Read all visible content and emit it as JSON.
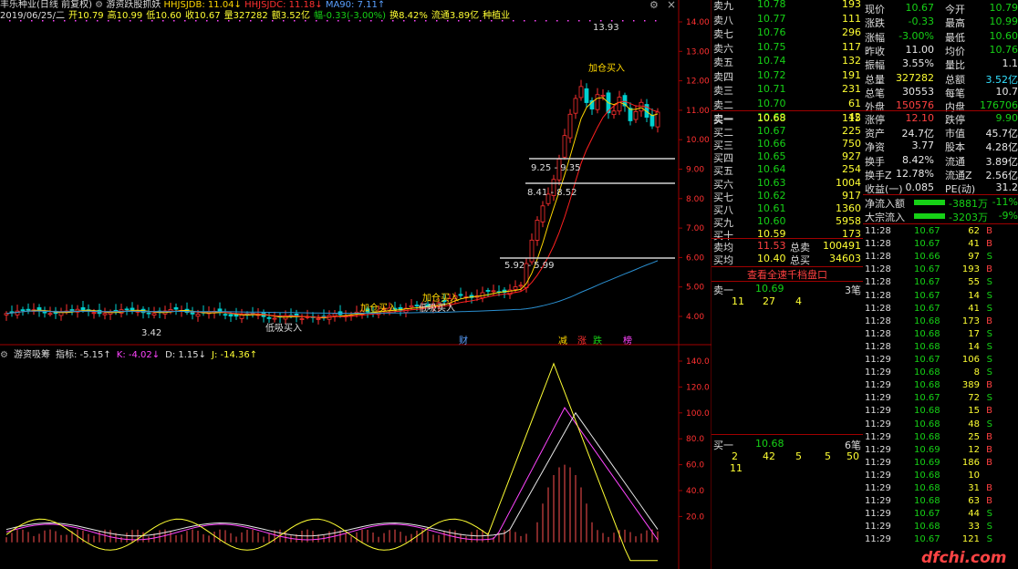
{
  "header": {
    "title": "丰乐种业(日线 前复权)",
    "indicator_name": "游资跃股抓妖",
    "hhjsjdb": "HHJSJDB: 11.04↓",
    "hhjsjdc": "HHJSJDC: 11.18↓",
    "ma90": "MA90: 7.11↑",
    "info_line": [
      "2019/06/25/二",
      "开10.79",
      "高10.99",
      "低10.60",
      "收10.67",
      "量327282",
      "额3.52亿",
      "幅-0.33(-3.00%)",
      "换8.42%",
      "流通3.89亿",
      "种植业"
    ]
  },
  "window_controls": {
    "gear": "⚙",
    "close": "×"
  },
  "main_chart": {
    "price_labels": [
      "14.00",
      "13.00",
      "12.00",
      "11.00",
      "10.00",
      "9.00",
      "8.00",
      "7.00",
      "6.00",
      "5.00",
      "4.00"
    ],
    "annotations": {
      "high": "13.93",
      "low": "3.42",
      "box1": "9.25 - 9.35",
      "box2": "8.41 - 8.52",
      "box3": "5.92 - 5.99",
      "buy1": "加仓买入",
      "buy2": "加仓买入",
      "buy3": "加仓买入",
      "buy4": "低吸买入",
      "buy5": "低吸买入",
      "cai": "财",
      "tags": [
        "减",
        "涨",
        "跌",
        "榜"
      ]
    },
    "colors": {
      "up": "#ff3030",
      "down": "#00d0d0",
      "ma_yellow": "#ffd700",
      "ma_red": "#ff2020",
      "ma_blue": "#2a8fd0"
    }
  },
  "sub_chart": {
    "name": "游资吸筹",
    "zhibiao": "指标: -5.15↑",
    "k": "K: -4.02↓",
    "d": "D: 1.15↓",
    "j": "J: -14.36↑",
    "labels": [
      "140.0",
      "120.0",
      "100.0",
      "80.0",
      "60.0",
      "40.0",
      "20.0"
    ]
  },
  "orderbook": {
    "sell": [
      {
        "label": "卖九",
        "price": "10.78",
        "vol": "193"
      },
      {
        "label": "卖八",
        "price": "10.77",
        "vol": "111"
      },
      {
        "label": "卖七",
        "price": "10.76",
        "vol": "296"
      },
      {
        "label": "卖六",
        "price": "10.75",
        "vol": "117"
      },
      {
        "label": "卖五",
        "price": "10.74",
        "vol": "132"
      },
      {
        "label": "卖四",
        "price": "10.72",
        "vol": "191"
      },
      {
        "label": "卖三",
        "price": "10.71",
        "vol": "231"
      },
      {
        "label": "卖二",
        "price": "10.70",
        "vol": "61"
      },
      {
        "label": "卖一",
        "price": "10.69",
        "vol": "42"
      }
    ],
    "buy": [
      {
        "label": "买一",
        "price": "10.68",
        "vol": "115"
      },
      {
        "label": "买二",
        "price": "10.67",
        "vol": "225"
      },
      {
        "label": "买三",
        "price": "10.66",
        "vol": "750"
      },
      {
        "label": "买四",
        "price": "10.65",
        "vol": "927"
      },
      {
        "label": "买五",
        "price": "10.64",
        "vol": "254"
      },
      {
        "label": "买六",
        "price": "10.63",
        "vol": "1004"
      },
      {
        "label": "买七",
        "price": "10.62",
        "vol": "917"
      },
      {
        "label": "买八",
        "price": "10.61",
        "vol": "1360"
      },
      {
        "label": "买九",
        "price": "10.60",
        "vol": "5958"
      },
      {
        "label": "买十",
        "price": "10.59",
        "vol": "173"
      }
    ],
    "avg_sell": {
      "label": "卖均",
      "price": "11.53",
      "tot_label": "总卖",
      "tot": "100491"
    },
    "avg_buy": {
      "label": "买均",
      "price": "10.40",
      "tot_label": "总买",
      "tot": "34603"
    },
    "view_all": "查看全速千档盘口",
    "sell1_detail": {
      "label": "卖一",
      "price": "10.69",
      "count": "3笔",
      "q": [
        "11",
        "27",
        "4"
      ]
    },
    "buy1_detail": {
      "label": "买一",
      "price": "10.68",
      "count": "6笔",
      "q": [
        "2",
        "42",
        "5",
        "5",
        "50",
        "11"
      ]
    }
  },
  "quote": [
    {
      "l1": "现价",
      "v1": "10.67",
      "l2": "今开",
      "v2": "10.79"
    },
    {
      "l1": "涨跌",
      "v1": "-0.33",
      "l2": "最高",
      "v2": "10.99"
    },
    {
      "l1": "涨幅",
      "v1": "-3.00%",
      "l2": "最低",
      "v2": "10.60"
    },
    {
      "l1": "昨收",
      "v1": "11.00",
      "l2": "均价",
      "v2": "10.76"
    },
    {
      "l1": "振幅",
      "v1": "3.55%",
      "l2": "量比",
      "v2": "1.1"
    },
    {
      "l1": "总量",
      "v1": "327282",
      "l2": "总额",
      "v2": "3.52亿"
    },
    {
      "l1": "总笔",
      "v1": "30553",
      "l2": "每笔",
      "v2": "10.7"
    },
    {
      "l1": "外盘",
      "v1": "150576",
      "l2": "内盘",
      "v2": "176706"
    }
  ],
  "quote2": [
    {
      "l1": "涨停",
      "v1": "12.10",
      "l2": "跌停",
      "v2": "9.90"
    },
    {
      "l1": "资产",
      "v1": "24.7亿",
      "l2": "市值",
      "v2": "45.7亿"
    },
    {
      "l1": "净资",
      "v1": "3.77",
      "l2": "股本",
      "v2": "4.28亿"
    },
    {
      "l1": "换手",
      "v1": "8.42%",
      "l2": "流通",
      "v2": "3.89亿"
    },
    {
      "l1": "换手Z",
      "v1": "12.78%",
      "l2": "流通Z",
      "v2": "2.56亿"
    },
    {
      "l1": "收益(一)",
      "v1": "0.085",
      "l2": "PE(动)",
      "v2": "31.2"
    }
  ],
  "flows": [
    {
      "label": "净流入额",
      "value": "-3881万",
      "pct": "-11%"
    },
    {
      "label": "大宗流入",
      "value": "-3203万",
      "pct": "-9%"
    }
  ],
  "trades": [
    {
      "t": "11:28",
      "p": "10.67",
      "v": "62",
      "bs": "B",
      "pc": "g"
    },
    {
      "t": "11:28",
      "p": "10.67",
      "v": "41",
      "bs": "B",
      "pc": "g"
    },
    {
      "t": "11:28",
      "p": "10.66",
      "v": "97",
      "bs": "S",
      "pc": "g"
    },
    {
      "t": "11:28",
      "p": "10.67",
      "v": "193",
      "bs": "B",
      "pc": "g"
    },
    {
      "t": "11:28",
      "p": "10.67",
      "v": "55",
      "bs": "S",
      "pc": "g"
    },
    {
      "t": "11:28",
      "p": "10.67",
      "v": "14",
      "bs": "S",
      "pc": "g"
    },
    {
      "t": "11:28",
      "p": "10.67",
      "v": "41",
      "bs": "S",
      "pc": "g"
    },
    {
      "t": "11:28",
      "p": "10.68",
      "v": "173",
      "bs": "B",
      "pc": "g"
    },
    {
      "t": "11:28",
      "p": "10.68",
      "v": "17",
      "bs": "S",
      "pc": "g"
    },
    {
      "t": "11:28",
      "p": "10.68",
      "v": "14",
      "bs": "S",
      "pc": "g"
    },
    {
      "t": "11:29",
      "p": "10.67",
      "v": "106",
      "bs": "S",
      "pc": "g"
    },
    {
      "t": "11:29",
      "p": "10.68",
      "v": "8",
      "bs": "S",
      "pc": "g"
    },
    {
      "t": "11:29",
      "p": "10.68",
      "v": "389",
      "bs": "B",
      "pc": "g"
    },
    {
      "t": "11:29",
      "p": "10.67",
      "v": "72",
      "bs": "S",
      "pc": "g"
    },
    {
      "t": "11:29",
      "p": "10.68",
      "v": "15",
      "bs": "B",
      "pc": "g"
    },
    {
      "t": "11:29",
      "p": "10.68",
      "v": "48",
      "bs": "S",
      "pc": "g"
    },
    {
      "t": "11:29",
      "p": "10.68",
      "v": "25",
      "bs": "B",
      "pc": "g"
    },
    {
      "t": "11:29",
      "p": "10.69",
      "v": "12",
      "bs": "B",
      "pc": "g"
    },
    {
      "t": "11:29",
      "p": "10.69",
      "v": "186",
      "bs": "B",
      "pc": "g"
    },
    {
      "t": "11:29",
      "p": "10.68",
      "v": "10",
      "bs": "",
      "pc": "g"
    },
    {
      "t": "11:29",
      "p": "10.68",
      "v": "31",
      "bs": "B",
      "pc": "g"
    },
    {
      "t": "11:29",
      "p": "10.68",
      "v": "63",
      "bs": "B",
      "pc": "g"
    },
    {
      "t": "11:29",
      "p": "10.67",
      "v": "44",
      "bs": "S",
      "pc": "g"
    },
    {
      "t": "11:29",
      "p": "10.68",
      "v": "33",
      "bs": "S",
      "pc": "g"
    },
    {
      "t": "11:29",
      "p": "10.67",
      "v": "121",
      "bs": "S",
      "pc": "g"
    }
  ],
  "watermark": "dfchi.com"
}
